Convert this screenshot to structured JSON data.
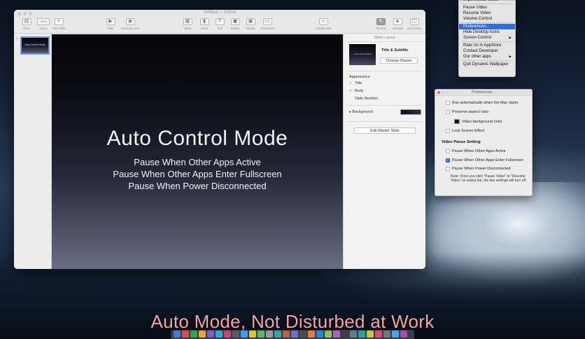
{
  "keynote": {
    "window_title": "Untitled — Edited",
    "toolbar": [
      {
        "label": "View",
        "icon": "view-icon",
        "glyph": "▤"
      },
      {
        "label": "Zoom",
        "icon": "zoom-icon",
        "glyph": "100%"
      },
      {
        "label": "Add Slide",
        "icon": "plus-icon",
        "glyph": "+"
      },
      {
        "label": "Play",
        "icon": "play-icon",
        "glyph": "▶"
      },
      {
        "label": "Keynote Live",
        "icon": "keynote-live-icon",
        "glyph": "◉"
      },
      {
        "label": "Table",
        "icon": "table-icon",
        "glyph": "▦"
      },
      {
        "label": "Chart",
        "icon": "chart-icon",
        "glyph": "▮"
      },
      {
        "label": "Text",
        "icon": "text-icon",
        "glyph": "T"
      },
      {
        "label": "Shape",
        "icon": "shape-icon",
        "glyph": "◼"
      },
      {
        "label": "Media",
        "icon": "media-icon",
        "glyph": "▣"
      },
      {
        "label": "Comment",
        "icon": "comment-icon",
        "glyph": "▭"
      },
      {
        "label": "Collaborate",
        "icon": "collaborate-icon",
        "glyph": "☺"
      },
      {
        "label": "Format",
        "icon": "format-icon",
        "glyph": "✎"
      },
      {
        "label": "Animate",
        "icon": "animate-icon",
        "glyph": "◈"
      },
      {
        "label": "Document",
        "icon": "document-icon",
        "glyph": "▢"
      }
    ],
    "navigator": {
      "slide_number": "1",
      "thumb_text": "Auto Control Mode"
    },
    "slide": {
      "title": "Auto Control Mode",
      "lines": [
        "Pause When Other Apps Active",
        "Pause When Other Apps Enter Fullscreen",
        "Pause When Power Disconnected"
      ]
    },
    "inspector": {
      "header": "Slide Layout",
      "master_name": "Title & Subtitle",
      "master_thumb_text": "Lorem Ipsum Dolor",
      "change_master": "Change Master",
      "appearance": "Appearance",
      "checks": [
        {
          "label": "Title",
          "checked": true
        },
        {
          "label": "Body",
          "checked": true
        },
        {
          "label": "Slide Number",
          "checked": false
        }
      ],
      "background": "Background",
      "edit_master": "Edit Master Slide"
    }
  },
  "menu": {
    "items": [
      {
        "label": "Import Local Video",
        "highlight": false,
        "submenu": false
      },
      {
        "sep": true
      },
      {
        "label": "Pause Video",
        "highlight": false,
        "submenu": false
      },
      {
        "label": "Resume Video",
        "highlight": false,
        "submenu": false
      },
      {
        "label": "Volume Control",
        "highlight": false,
        "submenu": false
      },
      {
        "sep": true
      },
      {
        "label": "Preferences...",
        "highlight": true,
        "submenu": false
      },
      {
        "label": "Hide Desktop Icons",
        "highlight": false,
        "submenu": false
      },
      {
        "label": "Screen Control",
        "highlight": false,
        "submenu": true
      },
      {
        "sep": true
      },
      {
        "label": "Rate Us in AppStore",
        "highlight": false,
        "submenu": false
      },
      {
        "label": "Contact Developer",
        "highlight": false,
        "submenu": false
      },
      {
        "label": "Our other apps",
        "highlight": false,
        "submenu": true
      },
      {
        "sep": true
      },
      {
        "label": "Quit Dynamic Wallpaper",
        "highlight": false,
        "submenu": false
      }
    ]
  },
  "preferences": {
    "title": "Preferences...",
    "run_auto": "Run automatically when the Mac starts",
    "preserve_aspect": "Preserve aspect ratio",
    "video_bg_color": "Video background color",
    "lock_screen": "Lock Screen Effect",
    "video_pause_heading": "Video Pause Setting",
    "pause_active": "Pause When Other Apps Active",
    "pause_fullscreen": "Pause When Other Apps Enter Fullscreen",
    "pause_power": "Pause When Power Disconnected",
    "note": "Note: Once you click \"Pause Video\" or \"Resume Video\" on status bar, the two settings will turn off."
  },
  "caption": "Auto Mode, Not Disturbed at Work",
  "colors": {
    "accent": "#2f6ed8",
    "caption": "#f5a3a6",
    "dock_icons": [
      "#3b7dd8",
      "#e04b3b",
      "#2aa84a",
      "#f3a51b",
      "#7b5bd6",
      "#1fb0d8",
      "#d83b7a",
      "#5a5a5a",
      "#33a0ff",
      "#e8c12e",
      "#4fbf6a",
      "#9a9a9a",
      "#2fa6a0",
      "#cc5a3a",
      "#6d6dd6",
      "#4a4a4a",
      "#ef7b2b",
      "#1e88e5",
      "#8bc34a",
      "#b55cc7",
      "#3c3c3c",
      "#607d8b",
      "#26a69a",
      "#c0ca33",
      "#ec407a",
      "#757575",
      "#42a5f5",
      "#ab47bc",
      "#8d6e63",
      "#78909c"
    ]
  }
}
